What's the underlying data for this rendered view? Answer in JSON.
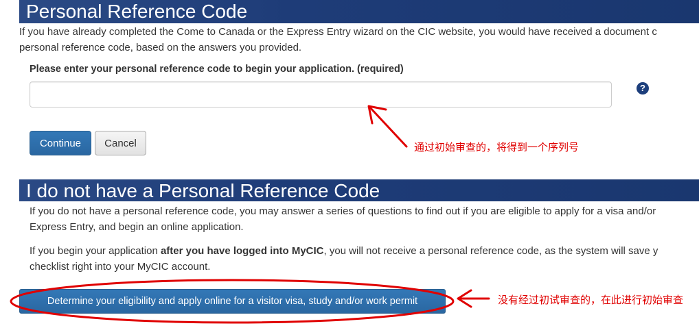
{
  "section1": {
    "heading": "Personal Reference Code",
    "intro_line1": "If you have already completed the Come to Canada or the Express Entry wizard on the CIC website, you would have received a document c",
    "intro_line2": "personal reference code, based on the answers you provided.",
    "field_label": "Please enter your personal reference code to begin your application. (required)",
    "field_value": "",
    "help_icon": "question-circle-icon",
    "help_glyph": "?",
    "continue_label": "Continue",
    "cancel_label": "Cancel"
  },
  "section2": {
    "heading": "I do not have a Personal Reference Code",
    "para1_line1": "If you do not have a personal reference code, you may answer a series of questions to find out if you are eligible to apply for a visa and/or",
    "para1_line2": "Express Entry, and begin an online application.",
    "para2_prefix": "If you begin your application ",
    "para2_bold": "after you have logged into MyCIC",
    "para2_suffix": ", you will not receive a personal reference code, as the system will save y",
    "para2_line2": "checklist right into your MyCIC account.",
    "determine_label": "Determine your eligibility and apply online for a visitor visa, study and/or work permit"
  },
  "annotations": {
    "note1": "通过初始审查的，将得到一个序列号",
    "note2": "没有经过初试审查的，在此进行初始审查",
    "color": "#e00000"
  },
  "colors": {
    "section_bar": "#1e3c78",
    "primary_button": "#2e6da4",
    "help_icon": "#1d3f7c"
  }
}
